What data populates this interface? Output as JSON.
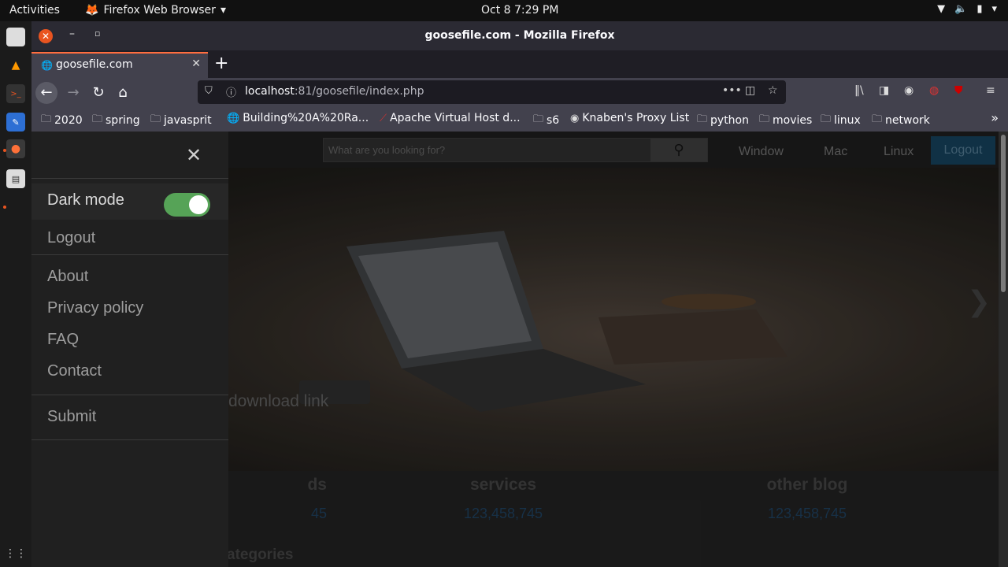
{
  "system": {
    "activities": "Activities",
    "app_name": "Firefox Web Browser",
    "clock": "Oct 8   7:29 PM"
  },
  "window": {
    "title": "goosefile.com - Mozilla Firefox"
  },
  "tab": {
    "label": "goosefile.com"
  },
  "urlbar": {
    "host": "localhost",
    "rest": ":81/goosefile/index.php"
  },
  "bookmarks": [
    "2020",
    "spring",
    "javasprit",
    "Building%20A%20Ra...",
    "Apache Virtual Host d...",
    "s6",
    "Knaben's Proxy List",
    "python",
    "movies",
    "linux",
    "network"
  ],
  "site": {
    "search_placeholder": "What are you looking for?",
    "nav": [
      "Window",
      "Mac",
      "Linux"
    ],
    "logout_button": "Logout",
    "hero_caption": "download link",
    "stats": [
      {
        "name": "ds",
        "value": "45"
      },
      {
        "name": "services",
        "value": "123,458,745"
      },
      {
        "name": "other blog",
        "value": "123,458,745"
      }
    ],
    "categories_heading": "ategories"
  },
  "drawer": {
    "dark_mode_label": "Dark mode",
    "dark_mode_on": true,
    "logout": "Logout",
    "about": "About",
    "privacy": "Privacy policy",
    "faq": "FAQ",
    "contact": "Contact",
    "submit": "Submit"
  },
  "colors": {
    "toggle_on": "#56a357",
    "logout_bg": "#133a52",
    "tab_accent": "#ff6d3f",
    "close_orange": "#e95420"
  }
}
